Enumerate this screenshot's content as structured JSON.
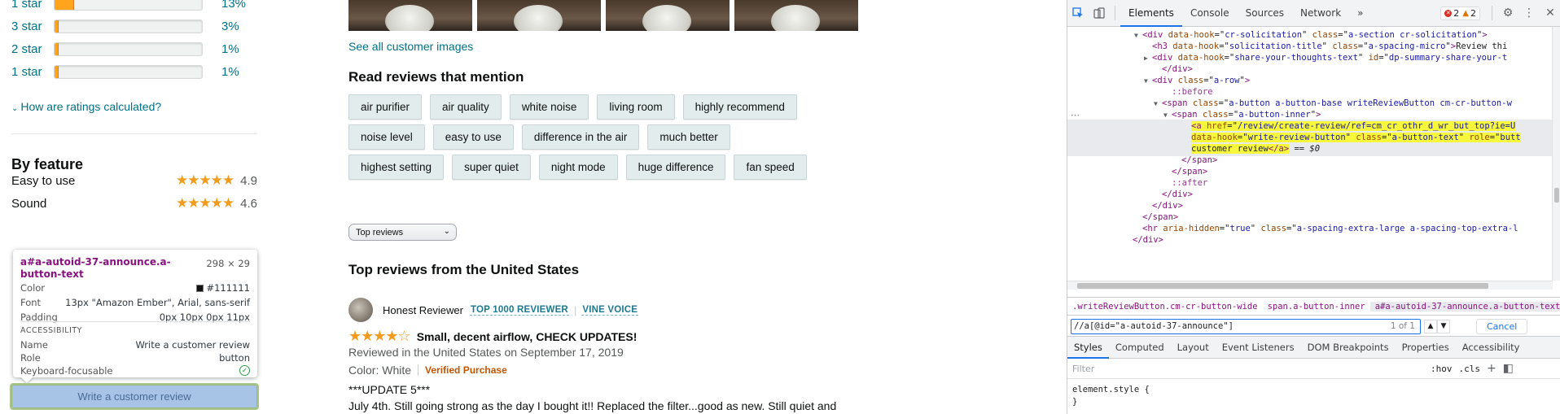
{
  "histogram": [
    {
      "label": "1 star",
      "pct": "13%",
      "fill": 0.13
    },
    {
      "label": "3 star",
      "pct": "3%",
      "fill": 0.03
    },
    {
      "label": "2 star",
      "pct": "1%",
      "fill": 0.01
    },
    {
      "label": "1 star",
      "pct": "1%",
      "fill": 0.01
    }
  ],
  "how_calc": "How are ratings calculated?",
  "by_feature": {
    "title": "By feature",
    "rows": [
      {
        "name": "Easy to use",
        "stars": "★★★★★",
        "score": "4.9"
      },
      {
        "name": "Sound",
        "stars": "★★★★★",
        "score": "4.6"
      }
    ]
  },
  "tooltip": {
    "title": "a#a-autoid-37-announce.a-button-text",
    "dims": "298 × 29",
    "color_label": "Color",
    "color_value": "#111111",
    "font_label": "Font",
    "font_value": "13px \"Amazon Ember\", Arial, sans-serif",
    "padding_label": "Padding",
    "padding_value": "0px 10px 0px 11px",
    "accessibility": "ACCESSIBILITY",
    "name_label": "Name",
    "name_value": "Write a customer review",
    "role_label": "Role",
    "role_value": "button",
    "focus_label": "Keyboard-focusable"
  },
  "write_review": "Write a customer review",
  "see_all": "See all customer images",
  "mention_title": "Read reviews that mention",
  "chips": [
    [
      "air purifier",
      "air quality",
      "white noise",
      "living room",
      "highly recommend"
    ],
    [
      "noise level",
      "easy to use",
      "difference in the air",
      "much better"
    ],
    [
      "highest setting",
      "super quiet",
      "night mode",
      "huge difference",
      "fan speed"
    ]
  ],
  "sort_value": "Top reviews",
  "top_reviews_title": "Top reviews from the United States",
  "review": {
    "reviewer": "Honest Reviewer",
    "badge1": "TOP 1000 REVIEWER",
    "badge2": "VINE VOICE",
    "stars": "★★★★☆",
    "rating": 4,
    "headline": "Small, decent airflow, CHECK UPDATES!",
    "meta": "Reviewed in the United States on September 17, 2019",
    "color": "Color: White",
    "verified": "Verified Purchase",
    "body1": "***UPDATE 5***",
    "body2": "July 4th. Still going strong as the day I bought it!! Replaced the filter...good as new. Still quiet and"
  },
  "devtools": {
    "tabs": [
      "Elements",
      "Console",
      "Sources",
      "Network"
    ],
    "more": "»",
    "errors": "2",
    "warnings": "2",
    "dom_lines": [
      {
        "indent": 6,
        "tri": "▼",
        "html": "<span class='tag'>&lt;div</span> <span class='attr'>data-hook</span>=\"<span class='val'>cr-solicitation</span>\" <span class='attr'>class</span>=\"<span class='val'>a-section cr-solicitation</span>\"<span class='tag'>&gt;</span>"
      },
      {
        "indent": 7,
        "tri": "",
        "html": "<span class='tag'>&lt;h3</span> <span class='attr'>data-hook</span>=\"<span class='val'>solicitation-title</span>\" <span class='attr'>class</span>=\"<span class='val'>a-spacing-micro</span>\"<span class='tag'>&gt;</span>Review thi"
      },
      {
        "indent": 7,
        "tri": "▶",
        "html": "<span class='tag'>&lt;div</span> <span class='attr'>data-hook</span>=\"<span class='val'>share-your-thoughts-text</span>\" <span class='attr'>id</span>=\"<span class='val'>dp-summary-share-your-t</span>"
      },
      {
        "indent": 8,
        "tri": "",
        "html": "<span class='tag'>&lt;/div&gt;</span>"
      },
      {
        "indent": 7,
        "tri": "▼",
        "html": "<span class='tag'>&lt;div</span> <span class='attr'>class</span>=\"<span class='val'>a-row</span>\"<span class='tag'>&gt;</span>"
      },
      {
        "indent": 9,
        "tri": "",
        "html": "<span class='pseudo'>::before</span>"
      },
      {
        "indent": 8,
        "tri": "▼",
        "html": "<span class='tag'>&lt;span</span> <span class='attr'>class</span>=\"<span class='val'>a-button a-button-base writeReviewButton cm-cr-button-w</span>"
      },
      {
        "indent": 9,
        "tri": "▼",
        "html": "<span class='tag'>&lt;span</span> <span class='attr'>class</span>=\"<span class='val'>a-button-inner</span>\"<span class='tag'>&gt;</span>"
      },
      {
        "indent": 11,
        "tri": "",
        "sel": true,
        "html": "<span class='hl'><span class='tag'>&lt;a</span> <span class='attr'>href</span>=\"<span class='val'>/review/create-review/ref=cm_cr_othr_d_wr_but_top?ie=U</span></span>"
      },
      {
        "indent": 11,
        "tri": "",
        "sel": true,
        "html": "<span class='hl'><span class='attr'>data-hook</span>=\"<span class='val'>write-review-button</span>\" <span class='attr'>class</span>=\"<span class='val'>a-button-text</span>\" <span class='attr'>role</span>=\"<span class='val'>butt</span></span>"
      },
      {
        "indent": 11,
        "tri": "",
        "sel": true,
        "html": "<span class='hl'>customer review<span class='tag'>&lt;/a&gt;</span></span> == <i>$0</i>"
      },
      {
        "indent": 10,
        "tri": "",
        "html": "<span class='tag'>&lt;/span&gt;</span>"
      },
      {
        "indent": 9,
        "tri": "",
        "html": "<span class='tag'>&lt;/span&gt;</span>"
      },
      {
        "indent": 9,
        "tri": "",
        "html": "<span class='pseudo'>::after</span>"
      },
      {
        "indent": 8,
        "tri": "",
        "html": "<span class='tag'>&lt;/div&gt;</span>"
      },
      {
        "indent": 7,
        "tri": "",
        "html": "<span class='tag'>&lt;/div&gt;</span>"
      },
      {
        "indent": 6,
        "tri": "",
        "html": "<span class='tag'>&lt;/span&gt;</span>"
      },
      {
        "indent": 6,
        "tri": "",
        "html": "<span class='tag'>&lt;hr</span> <span class='attr'>aria-hidden</span>=\"<span class='val'>true</span>\" <span class='attr'>class</span>=\"<span class='val'>a-spacing-extra-large a-spacing-top-extra-l</span>"
      },
      {
        "indent": 5,
        "tri": "",
        "html": "<span class='tag'>&lt;/div&gt;</span>"
      }
    ],
    "breadcrumbs": [
      ".writeReviewButton.cm-cr-button-wide",
      "span.a-button-inner",
      "a#a-autoid-37-announce.a-button-text"
    ],
    "search_value": "//a[@id=\"a-autoid-37-announce\"]",
    "search_count": "1 of 1",
    "cancel": "Cancel",
    "sub_tabs": [
      "Styles",
      "Computed",
      "Layout",
      "Event Listeners",
      "DOM Breakpoints",
      "Properties",
      "Accessibility"
    ],
    "filter_placeholder": "Filter",
    "hov": ":hov",
    "cls": ".cls",
    "styles_line1": "element.style {",
    "styles_line2": "}"
  }
}
